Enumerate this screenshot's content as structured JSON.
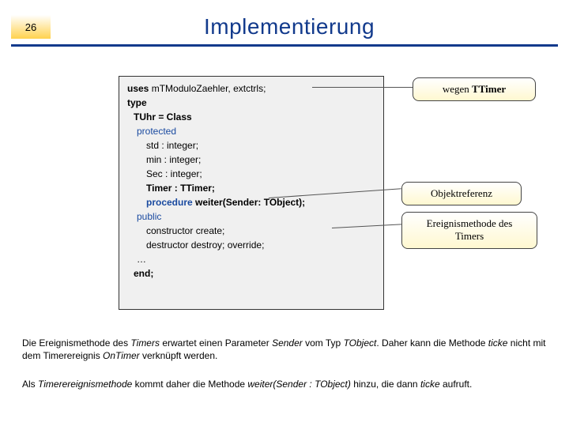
{
  "slide_number": "26",
  "title": "Implementierung",
  "code": {
    "uses_kw": "uses",
    "uses_val": "   mTModuloZaehler, extctrls;",
    "type_kw": "type",
    "class_decl": "TUhr = Class",
    "protected_kw": "protected",
    "fld_std": "std : integer;",
    "fld_min": "min : integer;",
    "fld_sec": "Sec : integer;",
    "fld_timer": "Timer : TTimer;",
    "proc_kw": "procedure",
    "proc_sig": " weiter(Sender: TObject);",
    "public_kw": "public",
    "ctor": "constructor create;",
    "dtor": "destructor destroy; override;",
    "dots": "…",
    "end_kw": "end;"
  },
  "callouts": {
    "c1_a": "wegen ",
    "c1_b": "TTimer",
    "c2": "Objektreferenz",
    "c3": "Ereignismethode des Timers"
  },
  "para1": {
    "t1": "Die Ereignismethode des ",
    "i1": "Timers",
    "t2": " erwartet einen Parameter ",
    "i2": "Sender",
    "t3": " vom Typ ",
    "i3": "TObject",
    "t4": ". Daher kann die Methode ",
    "i4": "ticke",
    "t5": " nicht mit dem Timerereignis ",
    "i5": "OnTimer",
    "t6": " verknüpft werden."
  },
  "para2": {
    "t1": "Als ",
    "i1": "Timerereignismethode",
    "t2": " kommt daher die Methode ",
    "i2": "weiter(Sender : TObject)",
    "t3": " hinzu, die dann ",
    "i3": "ticke",
    "t4": " aufruft."
  }
}
